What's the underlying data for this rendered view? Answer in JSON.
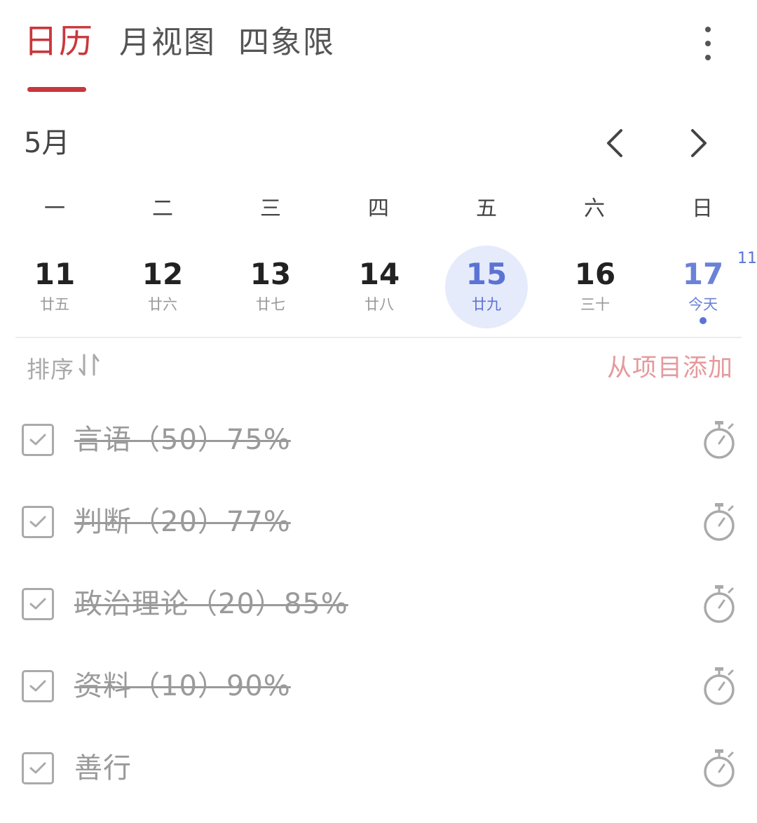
{
  "tabs": [
    {
      "label": "日历",
      "active": true
    },
    {
      "label": "月视图",
      "active": false
    },
    {
      "label": "四象限",
      "active": false
    }
  ],
  "more_icon": "more-vertical-icon",
  "month": "5月",
  "weekdays": [
    "一",
    "二",
    "三",
    "四",
    "五",
    "六",
    "日"
  ],
  "dates": [
    {
      "num": "11",
      "lunar": "廿五"
    },
    {
      "num": "12",
      "lunar": "廿六"
    },
    {
      "num": "13",
      "lunar": "廿七"
    },
    {
      "num": "14",
      "lunar": "廿八"
    },
    {
      "num": "15",
      "lunar": "廿九",
      "selected": true
    },
    {
      "num": "16",
      "lunar": "三十"
    },
    {
      "num": "17",
      "lunar": "今天",
      "today": true
    }
  ],
  "corner_badge": "11",
  "sort_label": "排序",
  "add_label": "从项目添加",
  "tasks": [
    {
      "text": "言语（50）75%",
      "done": true
    },
    {
      "text": "判断（20）77%",
      "done": true
    },
    {
      "text": "政治理论（20）85%",
      "done": true
    },
    {
      "text": "资料（10）90%",
      "done": true
    },
    {
      "text": "善行",
      "done": false
    }
  ],
  "colors": {
    "accent": "#c9373c",
    "selected": "#5b73d4",
    "selected_bg": "#e6ebfb",
    "add_link": "#e59a9c"
  }
}
